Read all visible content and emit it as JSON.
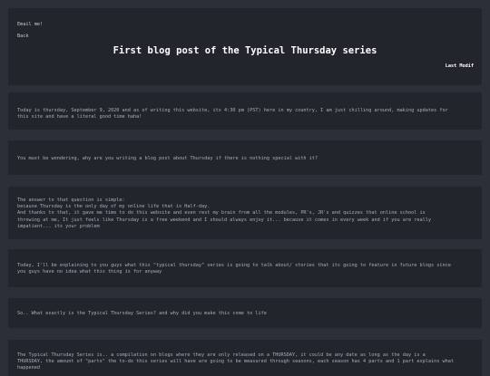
{
  "header": {
    "email_link": "Email me!",
    "back_link": "Back",
    "title": "First blog post of the Typical Thursday series",
    "last_modified": "Last Modif"
  },
  "paragraphs": [
    "Today is thursday, September 9, 2020 and as of writing this website, its 4:30 pm (PST) here in my country, I am just chilling around, making updates for\nthis site and have a literal good time haha!",
    "You must be wondering, why are you writing a blog post about Thursday if there is nothing special with it?",
    "The answer to that question is simple:\nbecause Thursday is the only day of my online life that is Half-day.\nAnd thanks to that, it gave me time to do this website and even rest my brain from all the modules, PR's, JR's and quizzes that online school is\nthrowing at me, It just feels like Thursday is a free weekend and I should always enjoy it... because it comes in every week and if you are really\nimpatient... its your problem",
    "Today, I'll be explaining to you guys what this \"typical thursday\" series is going to talk about/ stories that its going to feature in future blogs since\nyou guys have no idea what this thing is for anyway",
    "So.. What exactly is the Typical Thursday Series? and why did you make this come to life",
    "The Typical Thursday Series is.. a compilation on blogs where they are only released on a THURSDAY, it could be any date as long as the day is a\nTHURSDAY, the amount of \"parts\" the to-do this series will have are going to be measured through seasons, each season has 4 parts and 1 part explains what happened"
  ]
}
